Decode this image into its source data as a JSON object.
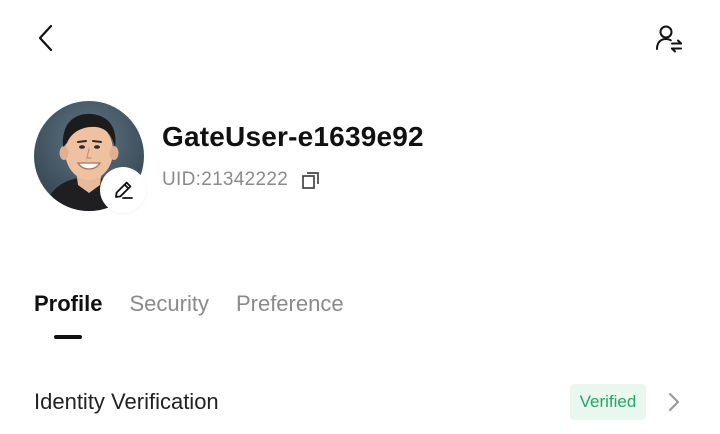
{
  "header": {
    "back_icon": "chevron-left-icon",
    "switch_account_icon": "user-switch-icon"
  },
  "profile": {
    "username": "GateUser-e1639e92",
    "uid": "UID:21342222",
    "copy_icon": "copy-icon",
    "edit_icon": "pencil-icon"
  },
  "tabs": [
    {
      "label": "Profile",
      "active": true
    },
    {
      "label": "Security",
      "active": false
    },
    {
      "label": "Preference",
      "active": false
    }
  ],
  "rows": [
    {
      "label": "Identity Verification",
      "badge": "Verified",
      "badge_color": "#1fa866",
      "badge_bg": "#e8f8ef"
    }
  ],
  "colors": {
    "text_primary": "#111111",
    "text_secondary": "#8a8a8a",
    "success": "#1fa866"
  }
}
